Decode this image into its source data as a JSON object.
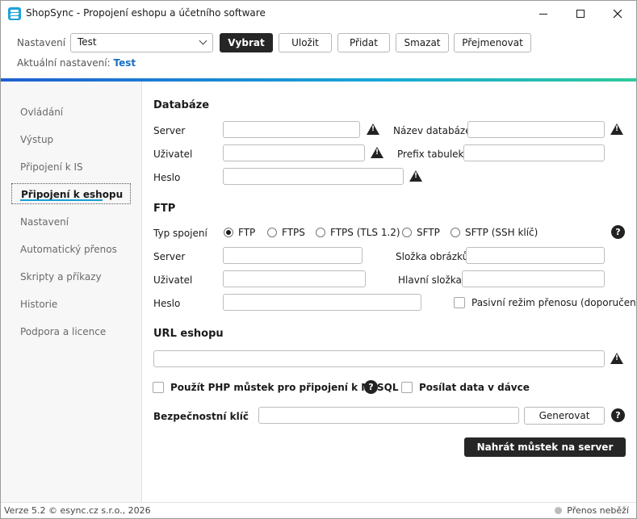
{
  "window": {
    "title": "ShopSync - Propojení eshopu a účetního software"
  },
  "toolbar": {
    "settings_label": "Nastavení",
    "settings_value": "Test",
    "select_label": "Vybrat",
    "save_label": "Uložit",
    "add_label": "Přidat",
    "delete_label": "Smazat",
    "rename_label": "Přejmenovat",
    "current_label": "Aktuální nastavení:",
    "current_value": "Test"
  },
  "sidebar": {
    "items": [
      {
        "label": "Ovládání"
      },
      {
        "label": "Výstup"
      },
      {
        "label": "Připojení k IS"
      },
      {
        "label": "Připojení k eshopu"
      },
      {
        "label": "Nastavení"
      },
      {
        "label": "Automatický přenos"
      },
      {
        "label": "Skripty a příkazy"
      },
      {
        "label": "Historie"
      },
      {
        "label": "Podpora a licence"
      }
    ],
    "active_index": 3
  },
  "database": {
    "title": "Databáze",
    "server_label": "Server",
    "server_value": "",
    "dbname_label": "Název databáze",
    "dbname_value": "",
    "user_label": "Uživatel",
    "user_value": "",
    "prefix_label": "Prefix tabulek",
    "prefix_value": "",
    "password_label": "Heslo",
    "password_value": ""
  },
  "ftp": {
    "title": "FTP",
    "type_label": "Typ spojení",
    "types": [
      "FTP",
      "FTPS",
      "FTPS (TLS 1.2)",
      "SFTP",
      "SFTP (SSH klíč)"
    ],
    "selected_type": "FTP",
    "server_label": "Server",
    "server_value": "",
    "images_label": "Složka obrázků",
    "images_value": "",
    "user_label": "Uživatel",
    "user_value": "",
    "main_folder_label": "Hlavní složka",
    "main_folder_value": "",
    "password_label": "Heslo",
    "password_value": "",
    "passive_label": "Pasivní režim přenosu (doporučeno)",
    "passive_checked": false
  },
  "url": {
    "title": "URL eshopu",
    "value": ""
  },
  "options": {
    "php_bridge_label": "Použít PHP můstek pro připojení k MySQL",
    "php_bridge_checked": false,
    "batch_label": "Posílat data v dávce",
    "batch_checked": false,
    "security_key_label": "Bezpečnostní klíč",
    "security_key_value": "",
    "generate_label": "Generovat",
    "upload_label": "Nahrát můstek na server"
  },
  "icons": {
    "warning": "warning-triangle-icon",
    "help": "help-circle-icon",
    "help_glyph": "?"
  },
  "statusbar": {
    "version": "Verze 5.2  © esync.cz s.r.o., 2026",
    "status": "Přenos neběží"
  },
  "colors": {
    "accent": "#1a6fc4",
    "primary_button": "#262626",
    "gradient_start": "#1f5fd0",
    "gradient_end": "#2ec99a"
  }
}
